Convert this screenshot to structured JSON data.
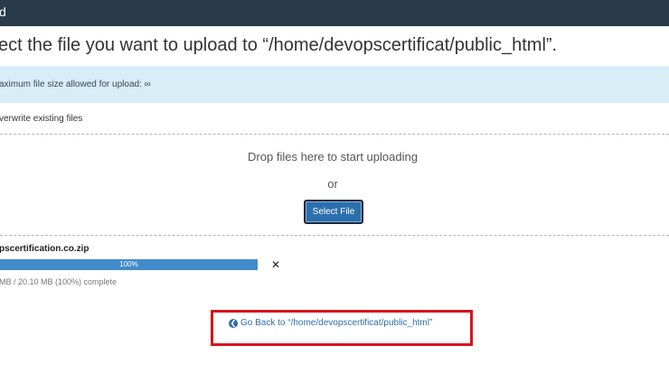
{
  "header": {
    "title": "d"
  },
  "page": {
    "heading": "ect the file you want to upload to “/home/devopscertificat/public_html”.",
    "max_size_notice": "aximum file size allowed for upload: ∞",
    "overwrite_label": "verwrite existing files"
  },
  "dropzone": {
    "text": "Drop files here to start uploading",
    "or": "or",
    "select_button": "Select File"
  },
  "upload": {
    "file_name": "pscertification.co.zip",
    "progress_percent": 100,
    "progress_label": "100%",
    "remove_icon": "✕",
    "size_text": "MB / 20.10 MB (100%) complete"
  },
  "back_link": {
    "icon": "arrow-left-circle-icon",
    "label": "Go Back to “/home/devopscertificat/public_html”"
  },
  "colors": {
    "header_bg": "#293a4a",
    "info_bg": "#d9edf7",
    "primary": "#2c6fad",
    "progress": "#428bca",
    "highlight": "#d9131e"
  }
}
